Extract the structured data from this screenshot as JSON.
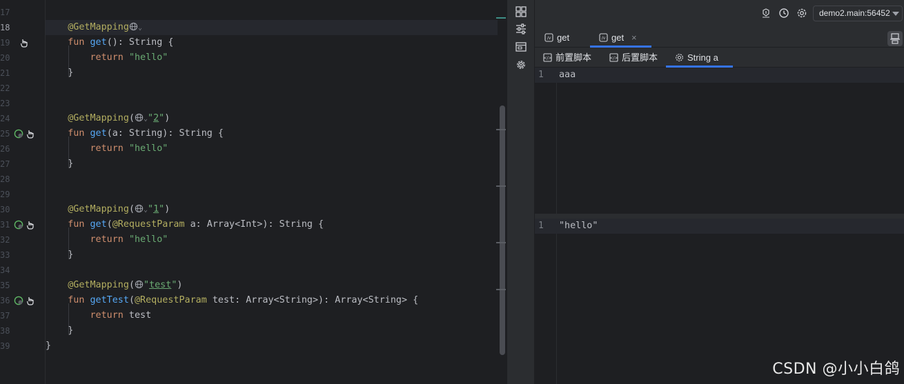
{
  "editor": {
    "current_line": 18,
    "line_numbers": [
      "17",
      "18",
      "19",
      "20",
      "21",
      "22",
      "23",
      "24",
      "25",
      "26",
      "27",
      "28",
      "29",
      "30",
      "31",
      "32",
      "33",
      "34",
      "35",
      "36",
      "37",
      "38",
      "39"
    ],
    "code": {
      "l18_ann": "@GetMapping",
      "l19_fun": "fun",
      "l19_name": "get",
      "l19_rest": "(): String {",
      "l20_ret": "return",
      "l20_str": "\"hello\"",
      "l21_brace": "}",
      "l24_ann": "@GetMapping",
      "l24_open": "(",
      "l24_str_q1": "\"",
      "l24_path": "2",
      "l24_str_q2": "\"",
      "l24_close": ")",
      "l25_fun": "fun",
      "l25_name": "get",
      "l25_rest": "(a: String): String {",
      "l26_ret": "return",
      "l26_str": "\"hello\"",
      "l27_brace": "}",
      "l30_ann": "@GetMapping",
      "l30_open": "(",
      "l30_str_q1": "\"",
      "l30_path": "1",
      "l30_str_q2": "\"",
      "l30_close": ")",
      "l31_fun": "fun",
      "l31_name": "get",
      "l31_p1": "(",
      "l31_ann": "@RequestParam",
      "l31_rest": " a: Array<Int>): String {",
      "l32_ret": "return",
      "l32_str": "\"hello\"",
      "l33_brace": "}",
      "l35_ann": "@GetMapping",
      "l35_open": "(",
      "l35_str_q1": "\"",
      "l35_path": "test",
      "l35_str_q2": "\"",
      "l35_close": ")",
      "l36_fun": "fun",
      "l36_name": "getTest",
      "l36_p1": "(",
      "l36_ann": "@RequestParam",
      "l36_rest": " test: Array<String>): Array<String> {",
      "l37_ret": "return",
      "l37_val": " test",
      "l38_brace": "}",
      "l39_brace": "}"
    }
  },
  "http_client": {
    "toolbar_icons": [
      "layout-icon",
      "settings-sliders-icon",
      "browser-window-icon",
      "gear-icon"
    ],
    "topbar_icons": [
      "debug-icon",
      "history-icon",
      "settings-gear-icon"
    ],
    "environment": "demo2.main:56452",
    "request_tabs": [
      {
        "label": "get",
        "active": false
      },
      {
        "label": "get",
        "active": true,
        "close": "×"
      }
    ],
    "sub_tabs": [
      {
        "label": "前置脚本",
        "active": false
      },
      {
        "label": "后置脚本",
        "active": false
      },
      {
        "label": "String a",
        "active": true
      }
    ],
    "request_body": {
      "line_number": "1",
      "text": "aaa"
    },
    "response_body": {
      "line_number": "1",
      "text": "\"hello\""
    }
  },
  "watermark": "CSDN @小小白鸽",
  "colors": {
    "background": "#1e1f22",
    "panel": "#2b2d30",
    "annotation": "#b3ae60",
    "keyword": "#cf8e6d",
    "function": "#56a8f5",
    "string": "#6aab73",
    "accent": "#3574f0",
    "run_icon": "#5fb865"
  }
}
